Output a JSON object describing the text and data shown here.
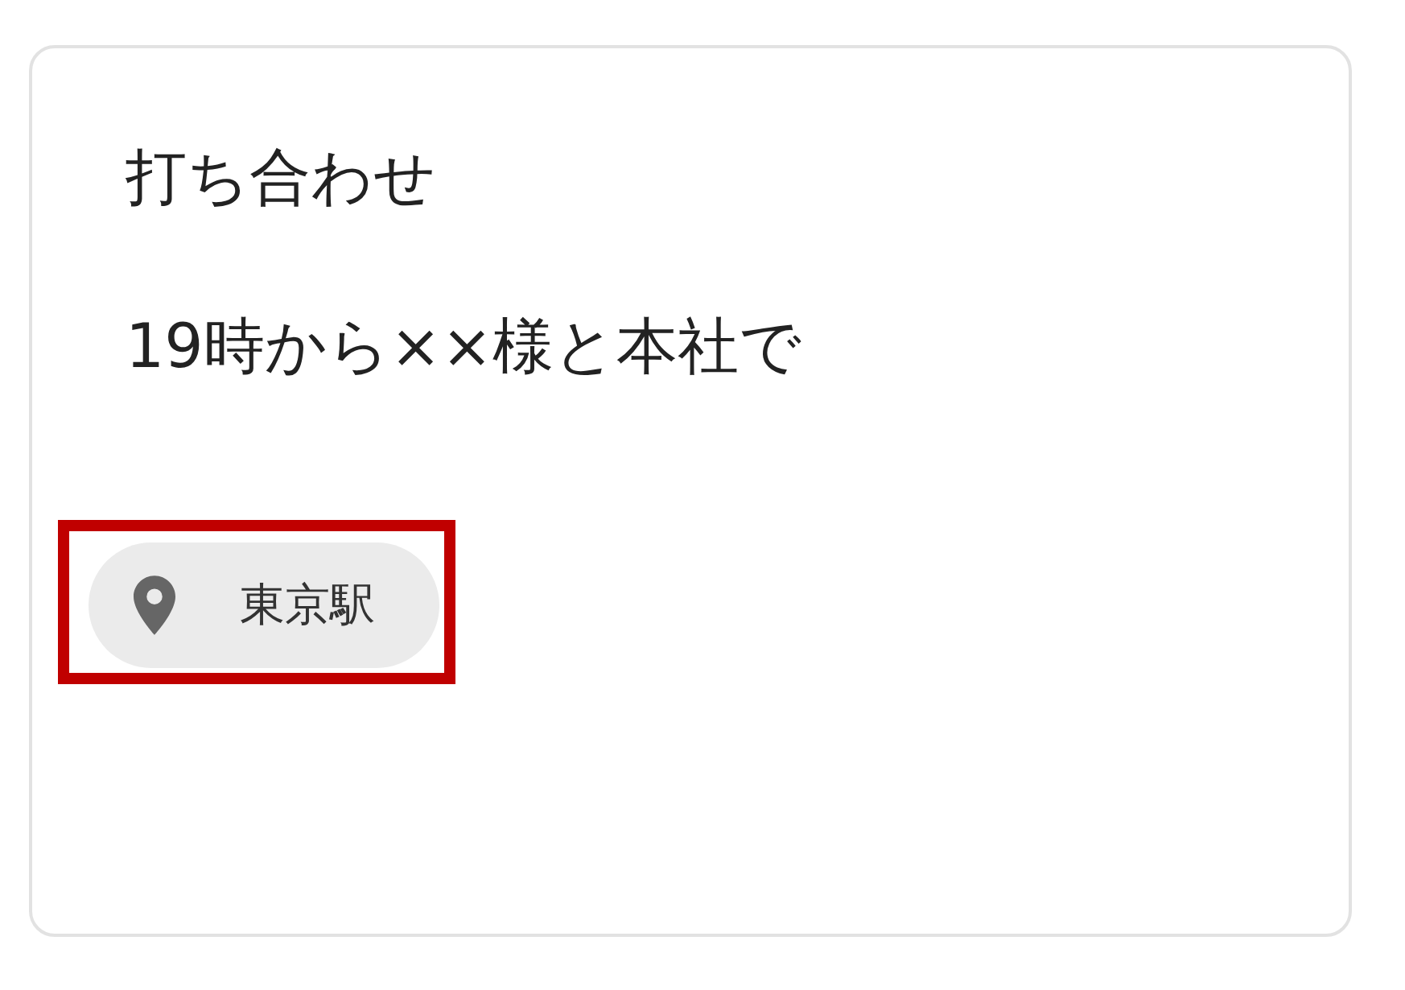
{
  "note": {
    "title": "打ち合わせ",
    "body": "19時から××様と本社で",
    "location": {
      "label": "東京駅",
      "highlighted": true
    }
  }
}
